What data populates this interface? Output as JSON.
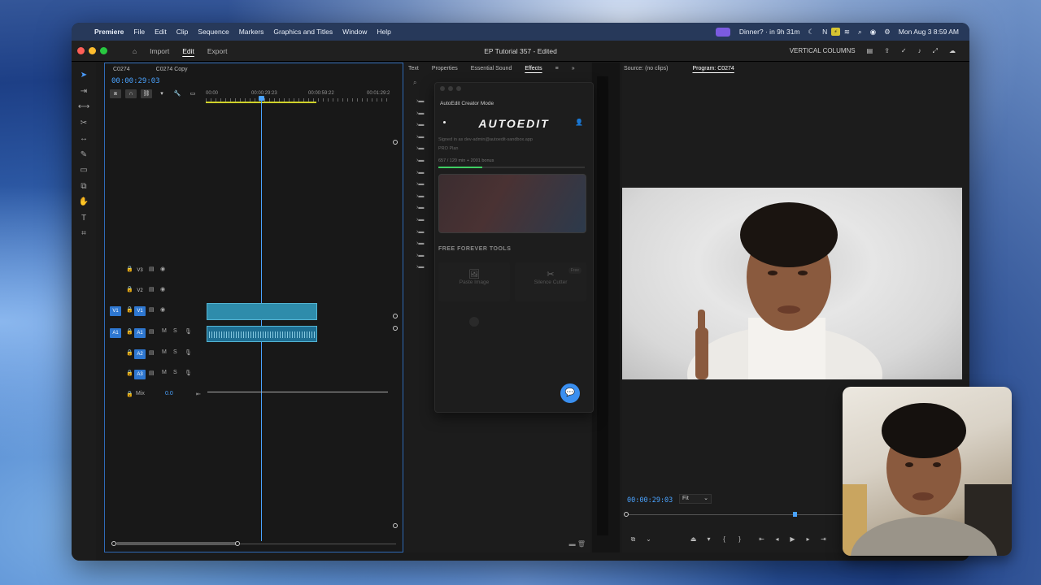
{
  "menubar": {
    "app": "Premiere",
    "menus": [
      "File",
      "Edit",
      "Clip",
      "Sequence",
      "Markers",
      "Graphics and Titles",
      "Window",
      "Help"
    ],
    "calendar_event": "Dinner? · in 9h 31m",
    "clock": "Mon Aug 3  8:59 AM"
  },
  "titlebar": {
    "nav": [
      "Import",
      "Edit",
      "Export"
    ],
    "document": "EP Tutorial 357 - Edited",
    "workspace": "VERTICAL COLUMNS"
  },
  "timeline": {
    "tabs": [
      "C0274",
      "C0274 Copy"
    ],
    "timecode": "00:00:29:03",
    "ruler": [
      "00:00",
      "00:00:29:23",
      "00:00:59:22",
      "00:01:29:2"
    ],
    "tracks": [
      {
        "src": "",
        "name": "V3"
      },
      {
        "src": "",
        "name": "V2"
      },
      {
        "src": "V1",
        "name": "V1"
      },
      {
        "src": "A1",
        "name": "A1"
      },
      {
        "src": "",
        "name": "A2"
      },
      {
        "src": "",
        "name": "A3"
      }
    ],
    "mix_label": "Mix",
    "mix_value": "0.0"
  },
  "effects": {
    "tabs": [
      "Text",
      "Properties",
      "Essential Sound",
      "Effects"
    ]
  },
  "plugin": {
    "panel_title": "AutoEdit Creator Mode",
    "logo": "AUTOEDIT",
    "signed_in": "Signed in as dev-admin@autoedit-sandbox.app",
    "plan": "PRO Plan",
    "usage": "657 / 120 min + 2001 bonus",
    "usage_fraction": 0.3,
    "section": "FREE FOREVER TOOLS",
    "tools": [
      {
        "label": "Paste Image",
        "icon": "image-icon",
        "badge": ""
      },
      {
        "label": "Silence Cutter",
        "icon": "scissors-icon",
        "badge": "Free"
      }
    ]
  },
  "monitor": {
    "tabs": [
      "Source: (no clips)",
      "Program: C0274"
    ],
    "timecode": "00:00:29:03",
    "fit": "Fit"
  },
  "colors": {
    "accent": "#4aa3ff",
    "clip": "#2e8cab",
    "fab": "#3a8ff0"
  }
}
